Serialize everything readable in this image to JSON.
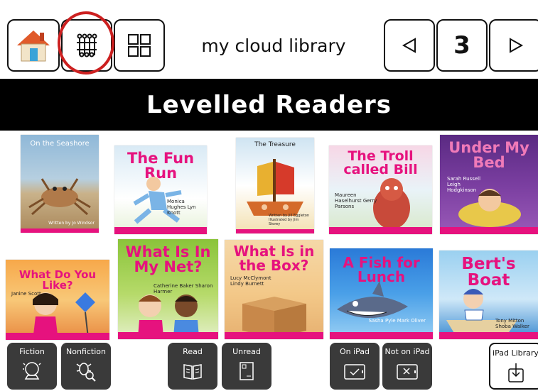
{
  "header": {
    "title": "my cloud library",
    "page_number": "3",
    "home_icon": "house-icon",
    "filter_icon": "filter-grid-icon",
    "grid_icon": "grid-view-icon",
    "prev_icon": "triangle-left-icon",
    "next_icon": "triangle-right-icon"
  },
  "banner": {
    "title": "Levelled Readers"
  },
  "books": [
    {
      "title": "On the Seashore",
      "credit": "Written by Jo Windsor"
    },
    {
      "title": "The Fun Run",
      "credit": "Monica Hughes  Lyn Knott"
    },
    {
      "title": "The Treasure",
      "credit": "Written by Jill Eggleton  Illustrated by Jim Storey"
    },
    {
      "title": "The Troll called Bill",
      "credit": "Maureen Haselhurst  Gerry Parsons"
    },
    {
      "title": "Under My Bed",
      "credit": "Sarah Russell  Leigh Hodgkinson"
    },
    {
      "title": "What Do You Like?",
      "credit": "Janine Scott"
    },
    {
      "title": "What Is In My Net?",
      "credit": "Catherine Baker  Sharon Harmer"
    },
    {
      "title": "What Is in the Box?",
      "credit": "Lucy McClymont  Lindy Burnett"
    },
    {
      "title": "A Fish for Lunch",
      "credit": "Sasha Pyle  Mark Oliver"
    },
    {
      "title": "Bert's Boat",
      "credit": "Tony Mitton  Shoba Walker"
    }
  ],
  "filters": {
    "fiction": "Fiction",
    "nonfiction": "Nonfiction",
    "read": "Read",
    "unread": "Unread",
    "on_ipad": "On iPad",
    "not_on_ipad": "Not on iPad",
    "ipad_library": "iPad Library"
  },
  "colors": {
    "highlight_ring": "#cc2020",
    "banner_bg": "#000000",
    "filter_bg": "#3a3a3a",
    "accent_pink": "#e6127e"
  }
}
